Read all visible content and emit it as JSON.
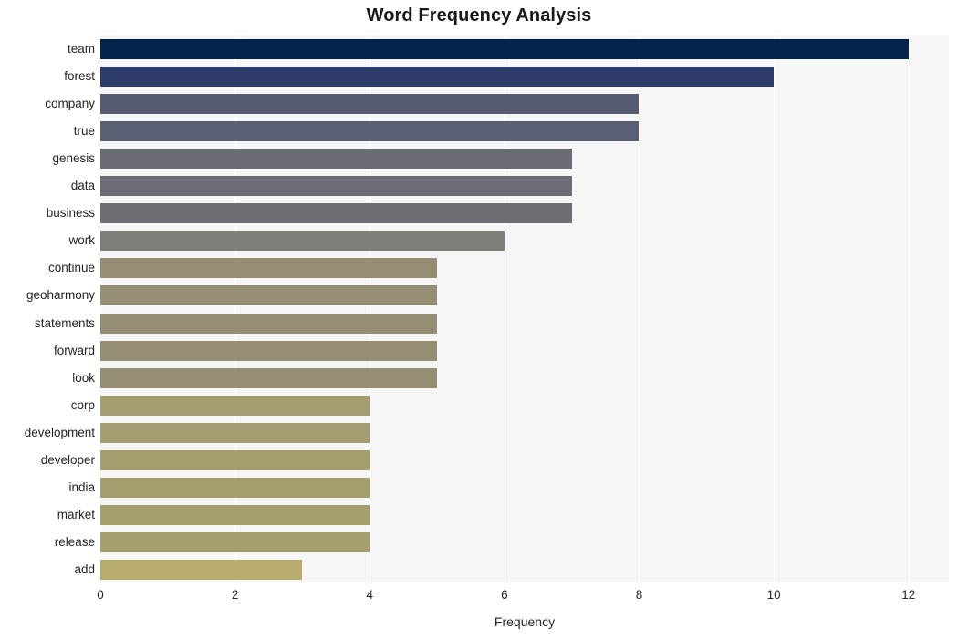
{
  "chart_data": {
    "type": "bar",
    "orientation": "horizontal",
    "title": "Word Frequency Analysis",
    "xlabel": "Frequency",
    "ylabel": "",
    "xlim": [
      0,
      12.6
    ],
    "xticks": [
      0,
      2,
      4,
      6,
      8,
      10,
      12
    ],
    "xtick_labels": [
      "0",
      "2",
      "4",
      "6",
      "8",
      "10",
      "12"
    ],
    "grid": "vertical-white-on-gray",
    "legend": "none",
    "categories": [
      "team",
      "forest",
      "company",
      "true",
      "genesis",
      "data",
      "business",
      "work",
      "continue",
      "geoharmony",
      "statements",
      "forward",
      "look",
      "corp",
      "development",
      "developer",
      "india",
      "market",
      "release",
      "add"
    ],
    "values": [
      12,
      10,
      8,
      8,
      7,
      7,
      7,
      6,
      5,
      5,
      5,
      5,
      5,
      4,
      4,
      4,
      4,
      4,
      4,
      3
    ],
    "bar_colors": [
      "#04234c",
      "#2d3c6b",
      "#585c72",
      "#5b5f73",
      "#6a6c74",
      "#6c6e75",
      "#6d6f75",
      "#7e7d78",
      "#948d74",
      "#948e74",
      "#948e74",
      "#948e73",
      "#948e73",
      "#a59c6f",
      "#a59c6f",
      "#a69d6f",
      "#a69d6e",
      "#a79e6e",
      "#a79e6e",
      "#b7ac6c"
    ]
  },
  "figure": {
    "background_color": "#ffffff",
    "plot_background_color": "#f6f6f6",
    "gridline_color": "#ffffff",
    "text_color": "#262626"
  }
}
